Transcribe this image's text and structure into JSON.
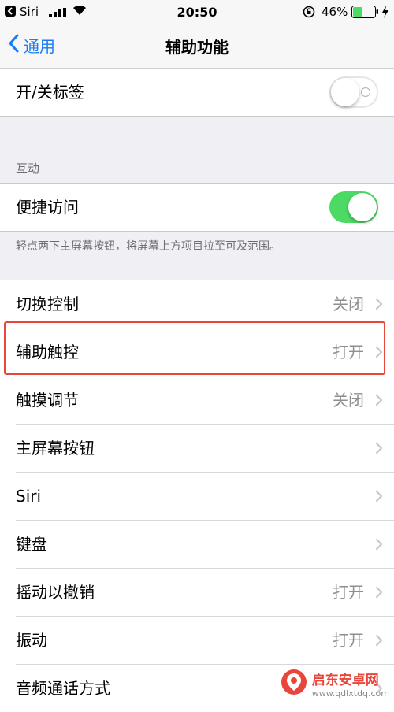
{
  "status_bar": {
    "carrier": "Siri",
    "time": "20:50",
    "battery_percent": "46%",
    "battery_level": 0.46,
    "accent_color": "#4cd964"
  },
  "nav": {
    "back_label": "通用",
    "title": "辅助功能",
    "accent_color": "#1a7cf6"
  },
  "top_group": {
    "label": "开/关标签",
    "switch_on": false
  },
  "interaction": {
    "header": "互动",
    "reachability_label": "便捷访问",
    "reachability_on": true,
    "footnote": "轻点两下主屏幕按钮，将屏幕上方项目拉至可及范围。"
  },
  "list": {
    "items": [
      {
        "label": "切换控制",
        "value": "关闭"
      },
      {
        "label": "辅助触控",
        "value": "打开"
      },
      {
        "label": "触摸调节",
        "value": "关闭"
      },
      {
        "label": "主屏幕按钮",
        "value": ""
      },
      {
        "label": "Siri",
        "value": ""
      },
      {
        "label": "键盘",
        "value": ""
      },
      {
        "label": "摇动以撤销",
        "value": "打开"
      },
      {
        "label": "振动",
        "value": "打开"
      },
      {
        "label": "音频通话方式",
        "value": ""
      }
    ]
  },
  "watermark": {
    "title": "启东安卓网",
    "url": "www.qdlxtdq.com",
    "color": "#e8463a"
  }
}
